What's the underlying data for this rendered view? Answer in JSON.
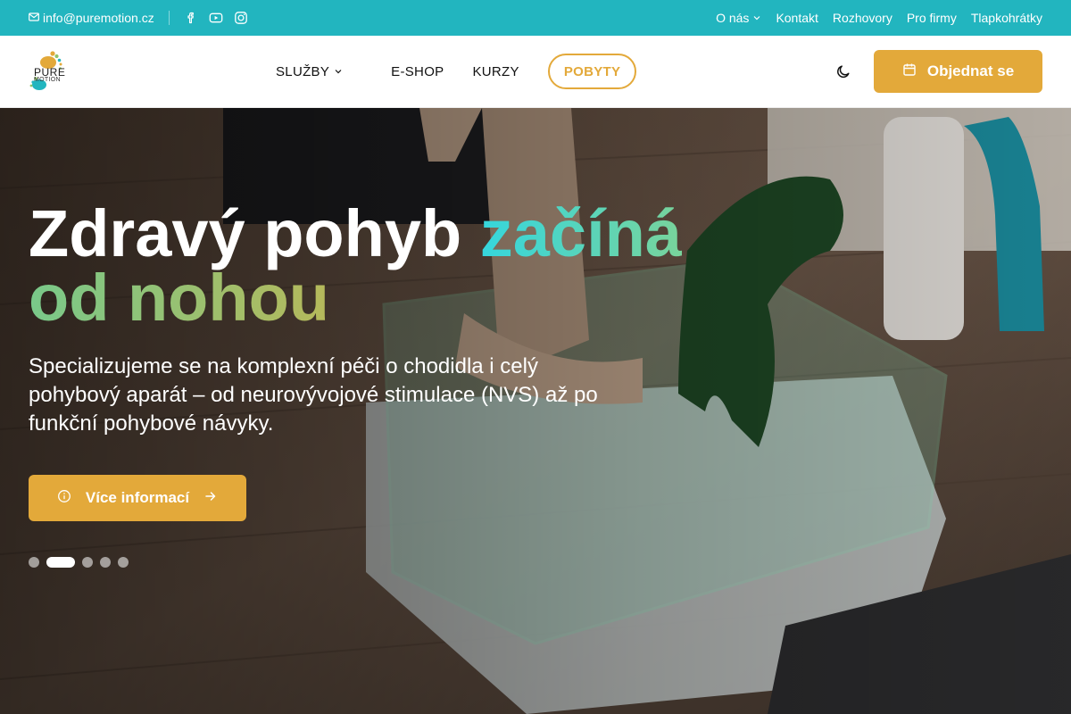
{
  "topbar": {
    "email": "info@puremotion.cz",
    "socials": [
      "facebook-icon",
      "youtube-icon",
      "instagram-icon"
    ],
    "links": [
      "O nás",
      "Kontakt",
      "Rozhovory",
      "Pro firmy",
      "Tlapkohrátky"
    ]
  },
  "header": {
    "logo_line1": "PURE",
    "logo_line2": "MOTION",
    "nav": {
      "sluzby": "SLUŽBY",
      "eshop": "E-SHOP",
      "kurzy": "KURZY",
      "pobyty": "POBYTY"
    },
    "cta_label": "Objednat se"
  },
  "hero": {
    "title_part1": "Zdravý pohyb ",
    "title_part2": "začíná",
    "title_part3": "od nohou",
    "subtitle": "Specializujeme se na komplexní péči o chodidla i celý pohybový aparát – od neurovývojové stimulace (NVS) až po funkční pohybové návyky.",
    "button_label": "Více informací",
    "slides_count": 5,
    "active_slide": 2
  },
  "colors": {
    "teal": "#22b5bf",
    "accent": "#e3a93a",
    "grad_teal": "#35d6dd",
    "grad_green": "#79c98a"
  }
}
